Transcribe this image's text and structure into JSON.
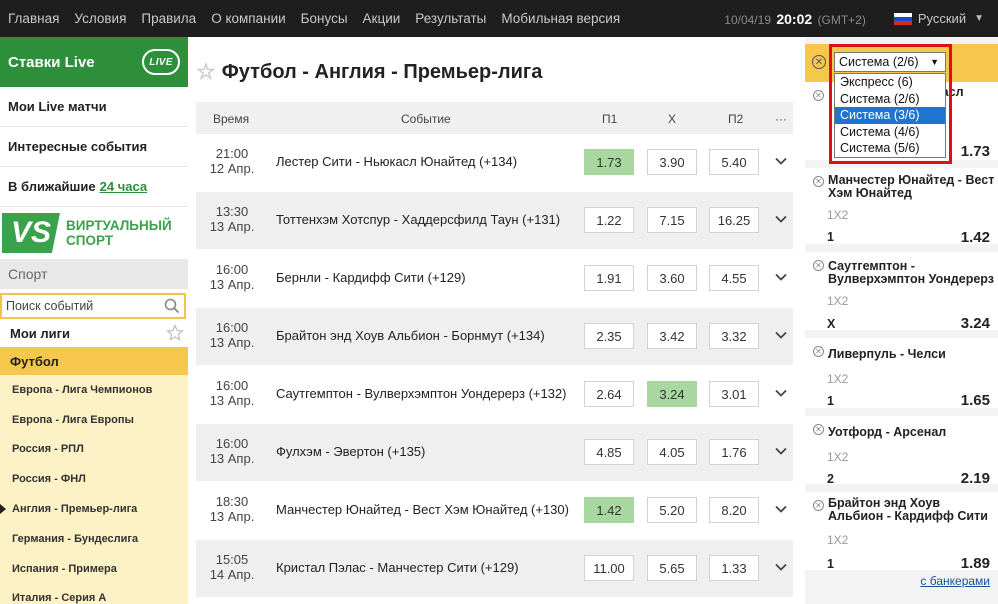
{
  "topnav": {
    "items": [
      "Главная",
      "Условия",
      "Правила",
      "О компании",
      "Бонусы",
      "Акции",
      "Результаты",
      "Мобильная версия"
    ],
    "date": "10/04/19",
    "time": "20:02",
    "tz": "(GMT+2)",
    "language": "Русский"
  },
  "sidebar": {
    "live_title": "Ставки Live",
    "live_badge": "LIVE",
    "links": [
      "Мои Live матчи",
      "Интересные события"
    ],
    "upcoming_prefix": "В ближайшие",
    "upcoming_accent": "24 часа",
    "vs_badge": "VS",
    "vs_line1": "ВИРТУАЛЬНЫЙ",
    "vs_line2": "СПОРТ",
    "sport_title": "Спорт",
    "search_placeholder": "Поиск событий",
    "my_leagues": "Мои лиги",
    "football": "Футбол",
    "leagues": [
      "Европа - Лига Чемпионов",
      "Европа - Лига Европы",
      "Россия - РПЛ",
      "Россия - ФНЛ",
      "Англия - Премьер-лига",
      "Германия - Бундеслига",
      "Испания - Примера",
      "Италия - Серия А"
    ]
  },
  "main": {
    "title": "Футбол - Англия - Премьер-лига",
    "columns": {
      "time": "Время",
      "event": "Событие",
      "p1": "П1",
      "x": "X",
      "p2": "П2",
      "more": "···"
    },
    "rows": [
      {
        "time": "21:00",
        "date": "12 Апр.",
        "event": "Лестер Сити - Ньюкасл Юнайтед (+134)",
        "p1": "1.73",
        "x": "3.90",
        "p2": "5.40",
        "selected": "p1"
      },
      {
        "time": "13:30",
        "date": "13 Апр.",
        "event": "Тоттенхэм Хотспур - Хаддерсфилд Таун (+131)",
        "p1": "1.22",
        "x": "7.15",
        "p2": "16.25",
        "selected": ""
      },
      {
        "time": "16:00",
        "date": "13 Апр.",
        "event": "Бернли - Кардифф Сити (+129)",
        "p1": "1.91",
        "x": "3.60",
        "p2": "4.55",
        "selected": ""
      },
      {
        "time": "16:00",
        "date": "13 Апр.",
        "event": "Брайтон энд Хоув Альбион - Борнмут (+134)",
        "p1": "2.35",
        "x": "3.42",
        "p2": "3.32",
        "selected": ""
      },
      {
        "time": "16:00",
        "date": "13 Апр.",
        "event": "Саутгемптон - Вулверхэмптон Уондерерз (+132)",
        "p1": "2.64",
        "x": "3.24",
        "p2": "3.01",
        "selected": "x"
      },
      {
        "time": "16:00",
        "date": "13 Апр.",
        "event": "Фулхэм - Эвертон (+135)",
        "p1": "4.85",
        "x": "4.05",
        "p2": "1.76",
        "selected": ""
      },
      {
        "time": "18:30",
        "date": "13 Апр.",
        "event": "Манчестер Юнайтед - Вест Хэм Юнайтед (+130)",
        "p1": "1.42",
        "x": "5.20",
        "p2": "8.20",
        "selected": "p1"
      },
      {
        "time": "15:05",
        "date": "14 Апр.",
        "event": "Кристал Пэлас - Манчестер Сити (+129)",
        "p1": "11.00",
        "x": "5.65",
        "p2": "1.33",
        "selected": ""
      }
    ]
  },
  "betslip": {
    "system_select": "Система (2/6)",
    "options": [
      "Экспресс (6)",
      "Система (2/6)",
      "Система (3/6)",
      "Система (4/6)",
      "Система (5/6)"
    ],
    "highlighted_option": "Система (3/6)",
    "bets": [
      {
        "name": "Лестер Сити - Ньюкасл Юнайтед",
        "visible_name": "...касл",
        "market": "",
        "outcome": "",
        "coef": "1.73"
      },
      {
        "name": "Манчестер Юнайтед - Вест Хэм Юнайтед",
        "market": "1X2",
        "outcome": "1",
        "coef": "1.42"
      },
      {
        "name": "Саутгемптон - Вулверхэмптон Уондерерз",
        "market": "1X2",
        "outcome": "X",
        "coef": "3.24"
      },
      {
        "name": "Ливерпуль - Челси",
        "market": "1X2",
        "outcome": "1",
        "coef": "1.65"
      },
      {
        "name": "Уотфорд - Арсенал",
        "market": "1X2",
        "outcome": "2",
        "coef": "2.19"
      },
      {
        "name": "Брайтон энд Хоув Альбион - Кардифф Сити",
        "market": "1X2",
        "outcome": "1",
        "coef": "1.89"
      }
    ],
    "bankers_link": "с банкерами"
  },
  "colors": {
    "topbar": "#1e1e1e",
    "live_green": "#2e8f3a",
    "football_yellow": "#f5c74d",
    "selected_odd": "#a8d8a0",
    "highlight_red": "#e01010"
  }
}
